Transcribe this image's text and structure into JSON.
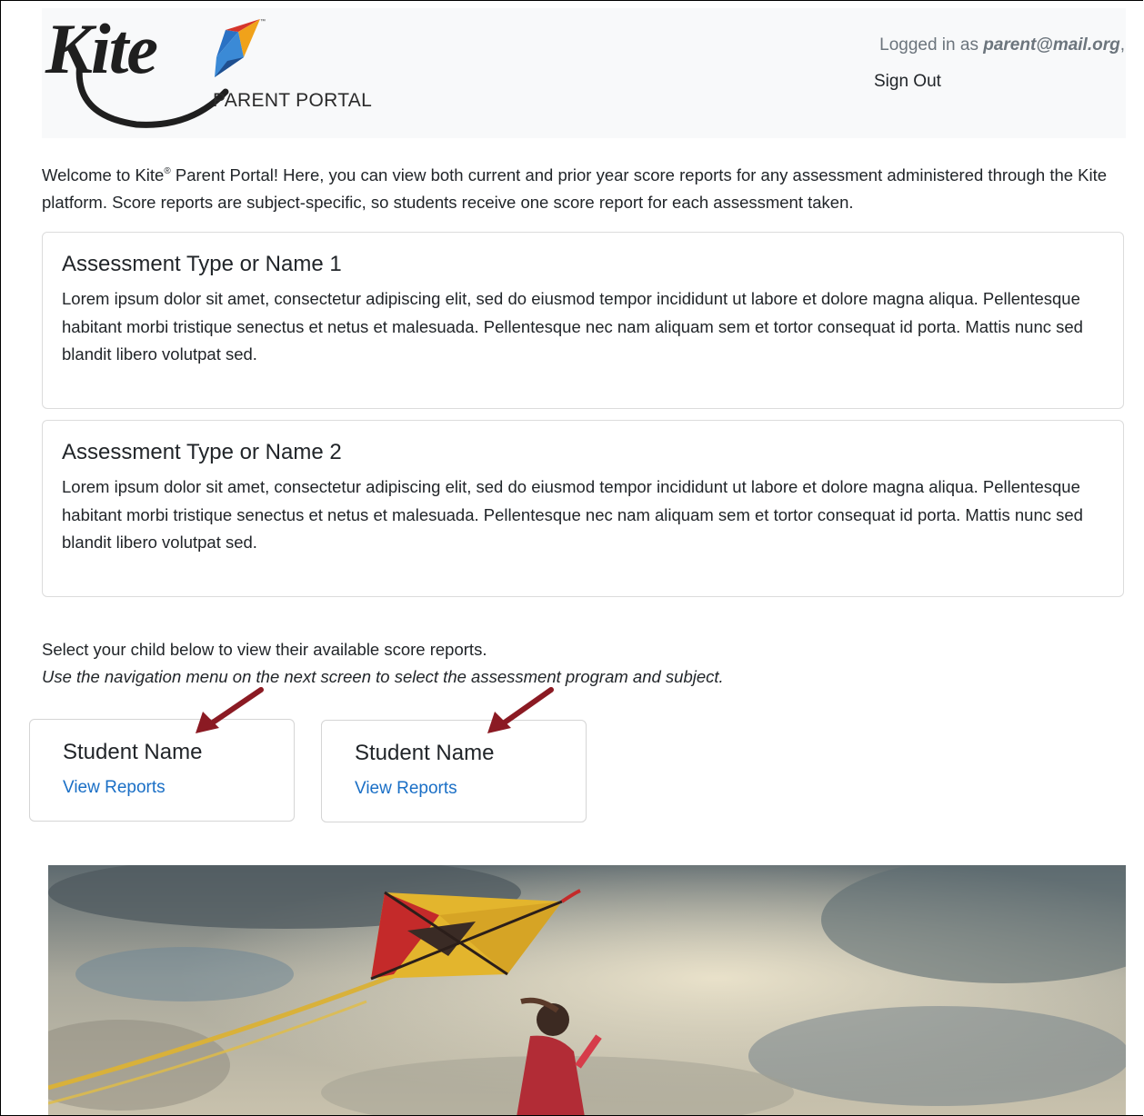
{
  "header": {
    "logo_word": "Kite",
    "logo_tm": "™",
    "logo_subtitle": "PARENT PORTAL",
    "login_prefix": "Logged in as ",
    "login_user": "parent@mail.org",
    "login_suffix": ",",
    "sign_out": "Sign Out"
  },
  "welcome": {
    "part1": "Welcome to Kite",
    "reg": "®",
    "part2": " Parent Portal! Here, you can view both current and prior year score reports for any assessment administered through the Kite platform. Score reports are subject-specific, so students receive one score report for each assessment taken."
  },
  "assessments": [
    {
      "title": "Assessment Type or Name 1",
      "body": "Lorem ipsum dolor sit amet, consectetur adipiscing elit, sed do eiusmod tempor incididunt ut labore et dolore magna aliqua. Pellentesque habitant morbi tristique senectus et netus et malesuada. Pellentesque nec nam aliquam sem et tortor consequat id porta. Mattis nunc sed blandit libero volutpat sed."
    },
    {
      "title": "Assessment Type or Name 2",
      "body": "Lorem ipsum dolor sit amet, consectetur adipiscing elit, sed do eiusmod tempor incididunt ut labore et dolore magna aliqua. Pellentesque habitant morbi tristique senectus et netus et malesuada. Pellentesque nec nam aliquam sem et tortor consequat id porta. Mattis nunc sed blandit libero volutpat sed."
    }
  ],
  "selection": {
    "instruction": "Select your child below to view their available score reports.",
    "note": "Use the navigation menu on the next screen to select the assessment program and subject."
  },
  "students": [
    {
      "name": "Student Name",
      "link": "View Reports"
    },
    {
      "name": "Student Name",
      "link": "View Reports"
    }
  ],
  "icons": {
    "logo_kite": "kite-logo-icon",
    "annotation_arrow": "arrow-icon"
  },
  "colors": {
    "link": "#1a6fc6",
    "header_bg": "#f8f9fa",
    "arrow": "#8b1a23",
    "kite_blue": "#2a72c4",
    "kite_orange": "#f0a21a",
    "kite_red": "#d5352b"
  }
}
